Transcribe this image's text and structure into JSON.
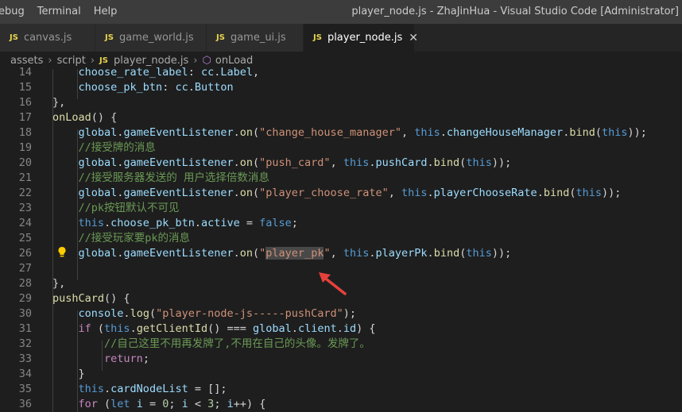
{
  "menu": [
    "ebug",
    "Terminal",
    "Help"
  ],
  "window_title": "player_node.js - ZhaJinHua - Visual Studio Code [Administrator]",
  "tabs": [
    {
      "label": "canvas.js",
      "icon": "JS"
    },
    {
      "label": "game_world.js",
      "icon": "JS"
    },
    {
      "label": "game_ui.js",
      "icon": "JS"
    },
    {
      "label": "player_node.js",
      "icon": "JS",
      "close": "✕"
    }
  ],
  "breadcrumb": [
    "assets",
    "script",
    "player_node.js",
    "onLoad"
  ],
  "code_lines": [
    {
      "n": "14",
      "text": "        choose_rate_label: cc.Label,"
    },
    {
      "n": "15",
      "text": "        choose_pk_btn: cc.Button"
    },
    {
      "n": "16",
      "text": "    },"
    },
    {
      "n": "17",
      "text": "    onLoad() {"
    },
    {
      "n": "18",
      "text": "        global.gameEventListener.on(\"change_house_manager\", this.changeHouseManager.bind(this));"
    },
    {
      "n": "19",
      "text": "        //接受牌的消息"
    },
    {
      "n": "20",
      "text": "        global.gameEventListener.on(\"push_card\", this.pushCard.bind(this));"
    },
    {
      "n": "21",
      "text": "        //接受服务器发送的 用户选择倍数消息"
    },
    {
      "n": "22",
      "text": "        global.gameEventListener.on(\"player_choose_rate\", this.playerChooseRate.bind(this));"
    },
    {
      "n": "23",
      "text": "        //pk按钮默认不可见"
    },
    {
      "n": "24",
      "text": "        this.choose_pk_btn.active = false;"
    },
    {
      "n": "25",
      "text": "        //接受玩家要pk的消息"
    },
    {
      "n": "26",
      "text": "        global.gameEventListener.on(\"player_pk\", this.playerPk.bind(this));"
    },
    {
      "n": "27",
      "text": ""
    },
    {
      "n": "28",
      "text": "    },"
    },
    {
      "n": "29",
      "text": "    pushCard() {"
    },
    {
      "n": "30",
      "text": "        console.log(\"player-node-js-----pushCard\");"
    },
    {
      "n": "31",
      "text": "        if (this.getClientId() === global.client.id) {"
    },
    {
      "n": "32",
      "text": "            //自己这里不用再发牌了,不用在自己的头像。发牌了。"
    },
    {
      "n": "33",
      "text": "            return;"
    },
    {
      "n": "34",
      "text": "        }"
    },
    {
      "n": "35",
      "text": "        this.cardNodeList = [];"
    },
    {
      "n": "36",
      "text": "        for (let i = 0; i < 3; i++) {"
    }
  ],
  "colors": {
    "background": "#1e1e1e",
    "keyword": "#569cd6",
    "string": "#ce9178",
    "comment": "#6a9955",
    "variable": "#9cdcfe",
    "function": "#dcdcaa",
    "annotation_arrow": "#e8413b"
  },
  "icons": {
    "lightbulb_line": "26",
    "annotation": "red-arrow"
  }
}
